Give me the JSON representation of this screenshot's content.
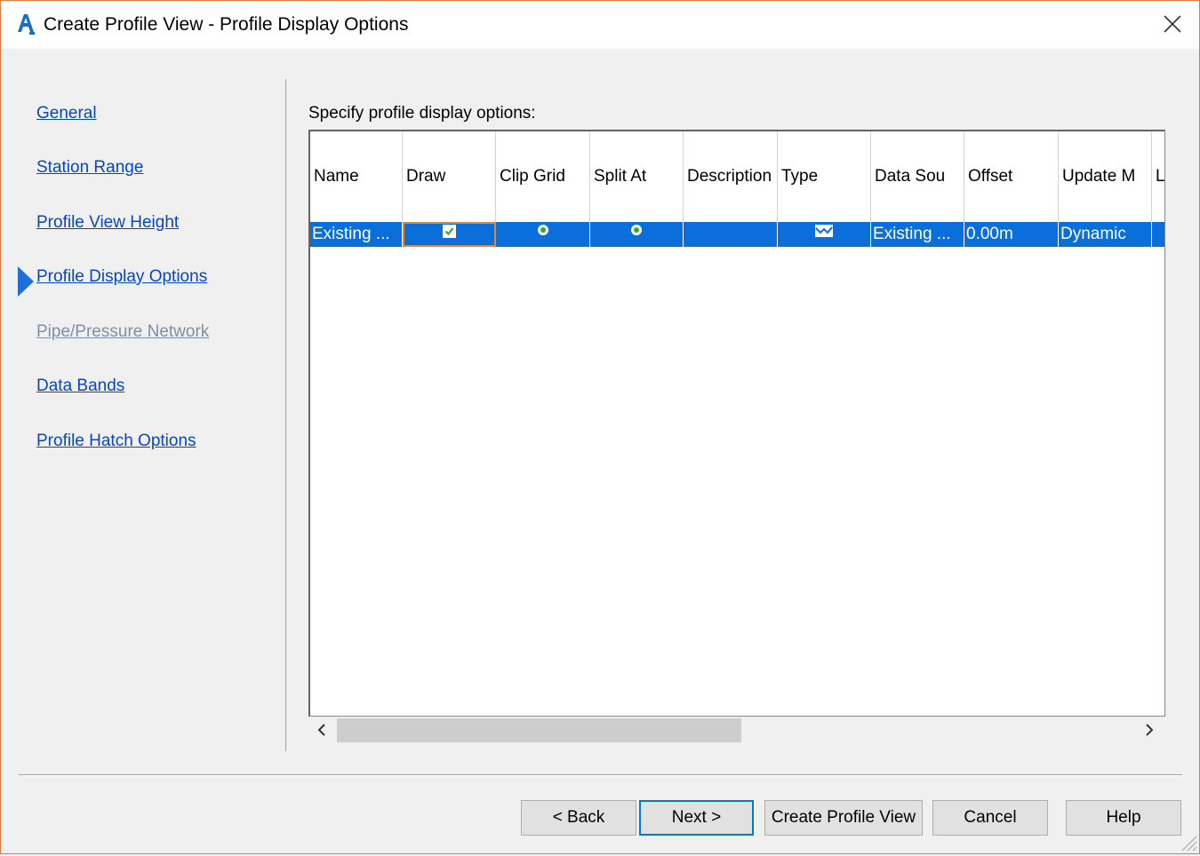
{
  "window": {
    "title": "Create Profile View - Profile Display Options",
    "app_icon": "autocad-civil-a-icon",
    "accent_border": "#e07a3a"
  },
  "nav": {
    "items": [
      {
        "label": "General",
        "enabled": true,
        "current": false
      },
      {
        "label": "Station Range",
        "enabled": true,
        "current": false
      },
      {
        "label": "Profile View Height",
        "enabled": true,
        "current": false
      },
      {
        "label": "Profile Display Options",
        "enabled": true,
        "current": true
      },
      {
        "label": "Pipe/Pressure Network",
        "enabled": false,
        "current": false
      },
      {
        "label": "Data Bands",
        "enabled": true,
        "current": false
      },
      {
        "label": "Profile Hatch Options",
        "enabled": true,
        "current": false
      }
    ]
  },
  "main": {
    "label": "Specify profile display options:",
    "grid": {
      "columns": [
        "Name",
        "Draw",
        "Clip Grid",
        "Split At",
        "Description",
        "Type",
        "Data Sou",
        "Offset",
        "Update M",
        "L"
      ],
      "rows": [
        {
          "name": "Existing ...",
          "draw": true,
          "clip_grid": true,
          "split_at": true,
          "description": "",
          "type_icon": "profile-type-icon",
          "data_source": "Existing ...",
          "offset": "0.00m",
          "update_mode": "Dynamic"
        }
      ],
      "selection_color": "#0a6fdb"
    }
  },
  "buttons": {
    "back": "< Back",
    "next": "Next >",
    "create": "Create Profile View",
    "cancel": "Cancel",
    "help": "Help"
  }
}
